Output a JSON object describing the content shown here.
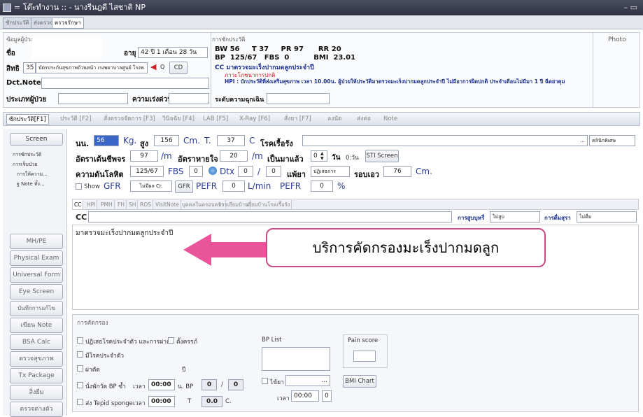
{
  "window": {
    "title": "= โต๊ะทำงาน :: - นางรีนฎดี ไสชาติ NP",
    "controls": "– ▭"
  },
  "toptabs": [
    "ซักประวัติ",
    "ส่งตรวจ",
    "ตรวจรักษา"
  ],
  "header": {
    "patient_label": "ข้อมูลผู้ป่วย",
    "name_label": "ชื่อ",
    "age_label": "อายุ",
    "age_value": "42 ปี 1 เดือน 28 วัน",
    "right_label": "สิทธิ",
    "right_code": "35",
    "right_value": "บัตรประกันสุขภาพถ้วนหน้า เรงพยาบาลศูนย์ โรงพ",
    "cd": "CD",
    "dct_label": "Dct.Note.",
    "ptype_label": "ประเภทผู้ป่วย",
    "urgency_label": "ความเร่งด่วน",
    "history_label": "การซักประวัติ",
    "vitals1": "BW 56     T 37     PR 97      RR 20",
    "vitals2": "BP  125/67   FBS  0          BMI  23.01",
    "cc": "CC  มาตรวจมะเร็งปากมดลูกประจำปี",
    "ptype_note": "ภาวะโภชนาการปกติ",
    "hpi": "HPI : บักประวัติที่ส่งเสริมสุขภาพ เวลา 10.00น. ผู้ป่วยให้ประวัติมาตรวจมะเร็งปากมดลูกประจำปี ไม่มีอาการผิดปกติ ประจำเดือนไม่มีมา 1 ปี ฉีดยาคุม",
    "level_label": "ระดับความฉุกเฉิน",
    "photo": "Photo"
  },
  "maintabs": [
    "ซักประวัติ[F1]",
    "ประวัติ [F2]",
    "สั่งตรวจจัดการ [F3]",
    "วินิจฉัย [F4]",
    "LAB [F5]",
    "X-Ray [F6]",
    "สั่งยา [F7]",
    "ลงนัด",
    "ส่งต่อ",
    "Note"
  ],
  "left": {
    "screen_label": "Screen",
    "tree": [
      "การซักประวัติ",
      "การเจ็บป่วย",
      "การให้ความ...",
      "ฐ Note ทั้ง..."
    ],
    "buttons": [
      "MH/PE",
      "Physical Exam",
      "Universal Form",
      "Eye Screen",
      "บันทึกการแก้ไข",
      "เขียน Note",
      "BSA Calc",
      "ตรวจสุขภาพ",
      "Tx Package",
      "สิ่งยืม",
      "ตรวจต่างตัว"
    ]
  },
  "vitals": {
    "wt_label": "นน.",
    "wt": "56",
    "kg": "Kg.",
    "ht_label": "สูง",
    "ht": "156",
    "cm": "Cm.",
    "t_label": "T.",
    "t": "37",
    "c": "C",
    "chronic": "โรคเรื้อรัง",
    "chronic_dots": "...",
    "chronic_btn": "คลินิกพิเศษ",
    "pulse_label": "อัตราเต้นชีพจร",
    "pulse": "97",
    "pm": "/m",
    "resp_label": "อัตราหายใจ",
    "resp": "20",
    "pm2": "/m",
    "onset_label": "เป็นมาแล้ว",
    "onset": "0",
    "day": "วัน",
    "day_unit": "0:วัน",
    "sti": "STI Screen",
    "bp_label": "ความดันโลหิต",
    "bp": "125/67",
    "fbs_label": "FBS",
    "fbs": "0",
    "dtx_label": "Dtx",
    "dtx": "0",
    "slash": "/",
    "dtx2": "0",
    "allergy_label": "แพ้ยา",
    "allergy": "ปฏิเสธการ",
    "waist_label": "รอบเอว",
    "waist": "76",
    "cm2": "Cm.",
    "show_gfr": "Show",
    "gfr_label": "GFR",
    "cr": "ไม่มีผล Cr.",
    "gfr_btn": "GFR",
    "pefr_label": "PEFR",
    "pefr": "0",
    "lmin": "L/min",
    "pefr2_label": "PEFR",
    "pefr2": "0",
    "pct": "%"
  },
  "inner_tabs": [
    "CC",
    "HPI",
    "PMH",
    "FH",
    "SH",
    "ROS",
    "VisitNote",
    "บุคคลในครอบครัว",
    "การเยี่ยมบ้าน",
    "เยี่ยมบ้านโรคเรื้อรัง"
  ],
  "cc_row": {
    "cc_label": "CC",
    "smoke_label": "การสูบบุหรี่",
    "smoke": "ไม่สูบ",
    "drink_label": "การดื่มสุรา",
    "drink": "ไม่ดื่ม"
  },
  "cc_text": "มาตรวจมะเร็งปากมดลูกประจำปี",
  "callout": "บริการคัดกรองมะเร็งปากมดลูก",
  "lower": {
    "title": "การคัดกรอง",
    "c1": "ปฏิเสธโรคประจำตัว และการผ่าตัด",
    "c2": "ตั้งครรภ์",
    "c3": "มีโรคประจำตัว",
    "c4": "ผ่าตัด",
    "pee": "ปี",
    "c5": "นั่งพักวัด BP ซ้ำ",
    "time": "เวลา",
    "t1": "00:00",
    "bp": "น. BP",
    "b1": "0",
    "slash": "/",
    "b2": "0",
    "c6": "ส่ง Tepid sponge",
    "t2": "00:00",
    "tlabel": "T",
    "tval": "0.0",
    "cunit": "C.",
    "bplist": "BP List",
    "pain": "Pain score",
    "fever": "ไข้ยา",
    "fever_dots": "...",
    "t3": "00:00",
    "t3v": "0",
    "bmichart": "BMI Chart"
  },
  "colors": {
    "title_bg": "#2e3142",
    "accent": "#c94b86",
    "arrow": "#e8559a"
  }
}
